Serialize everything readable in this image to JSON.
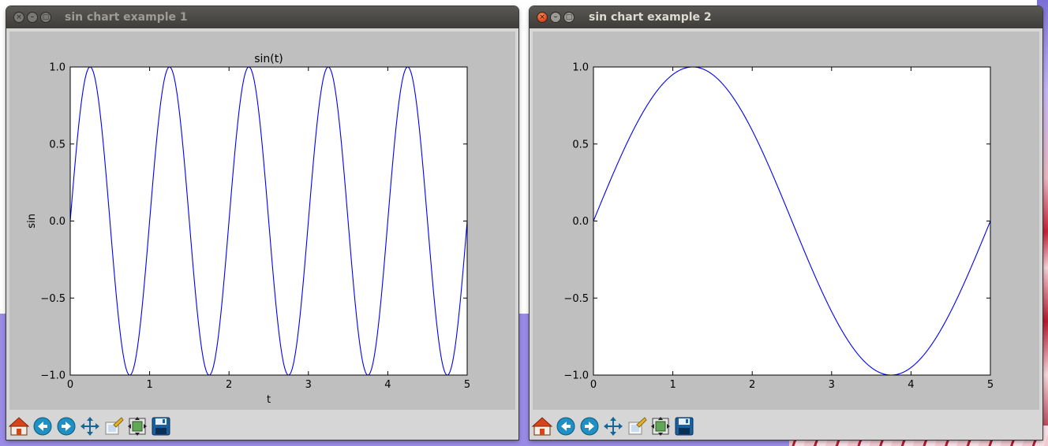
{
  "desktop": {
    "background_accent": "#9b8be8"
  },
  "windows": [
    {
      "title": "sin chart example 1",
      "focused": false,
      "toolbar": [
        "home-icon",
        "back-icon",
        "forward-icon",
        "pan-icon",
        "zoom-icon",
        "subplots-icon",
        "save-icon"
      ],
      "chart_data": {
        "type": "line",
        "title": "sin(t)",
        "xlabel": "t",
        "ylabel": "sin",
        "xlim": [
          0,
          5
        ],
        "ylim": [
          -1.0,
          1.0
        ],
        "x_ticks": [
          "0",
          "1",
          "2",
          "3",
          "4",
          "5"
        ],
        "y_ticks": [
          "1.0",
          "0.5",
          "0.0",
          "−0.5",
          "−1.0"
        ],
        "series": [
          {
            "function": "sin(2*pi*t)",
            "frequency_hz": 1,
            "x_range": [
              0,
              5
            ],
            "color": "#0000ff"
          }
        ],
        "grid": false
      }
    },
    {
      "title": "sin chart example 2",
      "focused": true,
      "toolbar": [
        "home-icon",
        "back-icon",
        "forward-icon",
        "pan-icon",
        "zoom-icon",
        "subplots-icon",
        "save-icon"
      ],
      "chart_data": {
        "type": "line",
        "title": "",
        "xlabel": "",
        "ylabel": "",
        "xlim": [
          0,
          5
        ],
        "ylim": [
          -1.0,
          1.0
        ],
        "x_ticks": [
          "0",
          "1",
          "2",
          "3",
          "4",
          "5"
        ],
        "y_ticks": [
          "1.0",
          "0.5",
          "0.0",
          "−0.5",
          "−1.0"
        ],
        "series": [
          {
            "function": "sin(2*pi*t/5)",
            "frequency_hz": 0.2,
            "x_range": [
              0,
              5
            ],
            "color": "#0000ff"
          }
        ],
        "grid": false
      }
    }
  ]
}
